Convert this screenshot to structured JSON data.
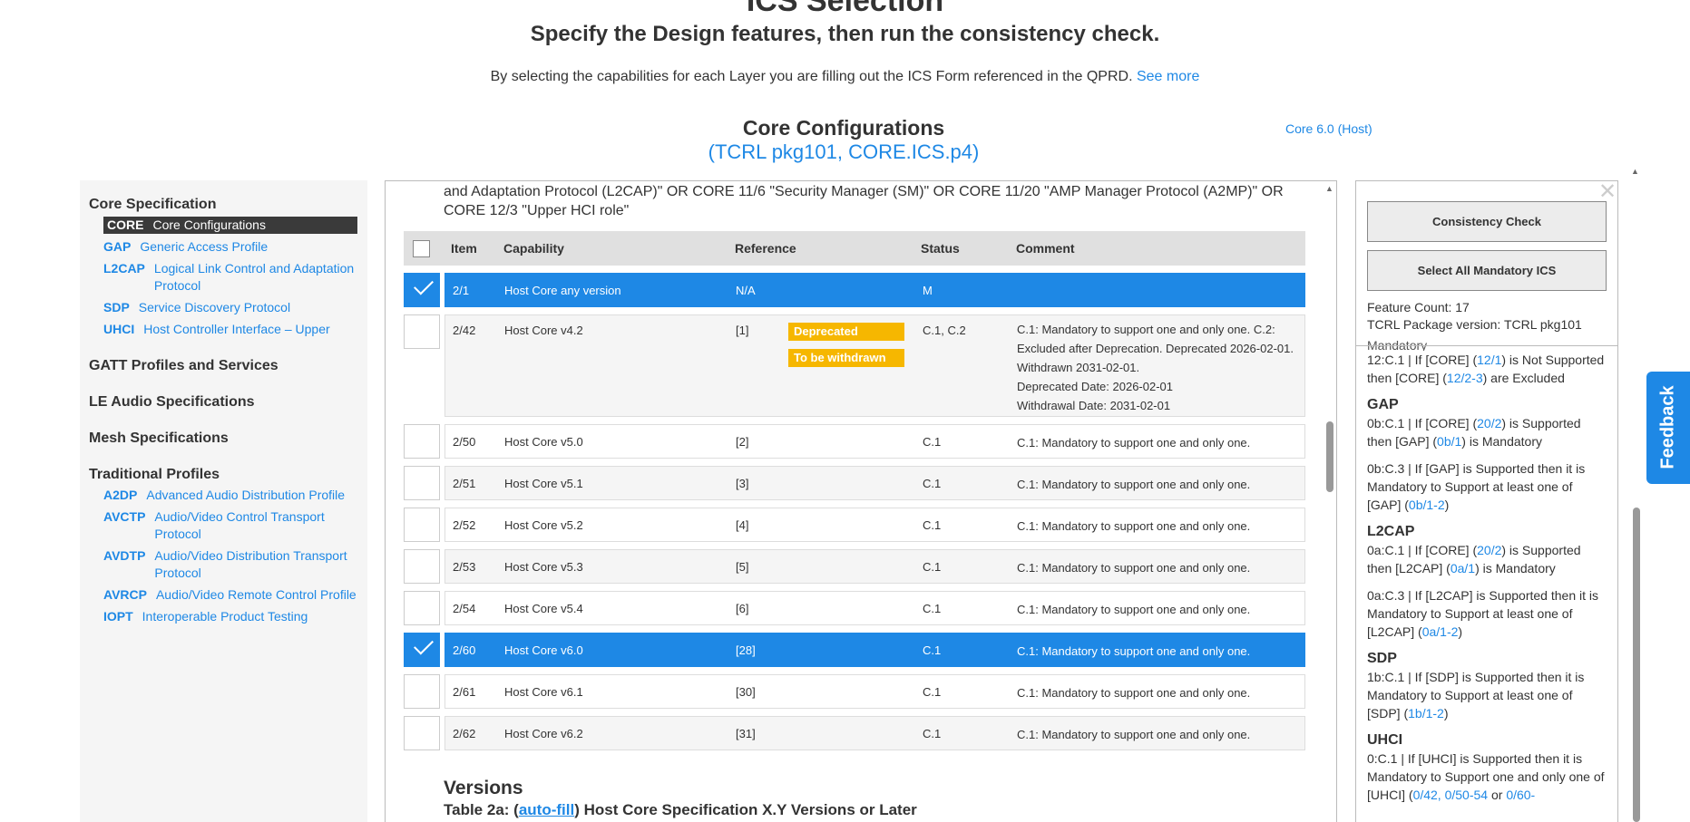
{
  "page": {
    "title": "ICS Selection",
    "subtitle": "Specify the Design features, then run the consistency check.",
    "intro": "By selecting the capabilities for each Layer you are filling out the ICS Form referenced in the QPRD.",
    "see_more": "See more",
    "config_title": "Core Configurations",
    "config_sub": "(TCRL pkg101, CORE.ICS.p4)",
    "version_link": "Core 6.0 (Host)"
  },
  "sidebar": {
    "core_spec": "Core Specification",
    "core_items": [
      {
        "abbr": "CORE",
        "full": "Core Configurations"
      },
      {
        "abbr": "GAP",
        "full": "Generic Access Profile"
      },
      {
        "abbr": "L2CAP",
        "full": "Logical Link Control and Adaptation Protocol"
      },
      {
        "abbr": "SDP",
        "full": "Service Discovery Protocol"
      },
      {
        "abbr": "UHCI",
        "full": "Host Controller Interface – Upper"
      }
    ],
    "gatt": "GATT Profiles and Services",
    "le_audio": "LE Audio Specifications",
    "mesh": "Mesh Specifications",
    "traditional": "Traditional Profiles",
    "trad_items": [
      {
        "abbr": "A2DP",
        "full": "Advanced Audio Distribution Profile"
      },
      {
        "abbr": "AVCTP",
        "full": "Audio/Video Control Transport Protocol"
      },
      {
        "abbr": "AVDTP",
        "full": "Audio/Video Distribution Transport Protocol"
      },
      {
        "abbr": "AVRCP",
        "full": "Audio/Video Remote Control Profile"
      },
      {
        "abbr": "IOPT",
        "full": "Interoperable Product Testing"
      }
    ]
  },
  "center": {
    "intro_text": "and Adaptation Protocol (L2CAP)\" OR CORE 11/6 \"Security Manager (SM)\" OR CORE 11/20 \"AMP Manager Protocol (A2MP)\" OR CORE 12/3 \"Upper HCI role\"",
    "headers": {
      "item": "Item",
      "capability": "Capability",
      "reference": "Reference",
      "status": "Status",
      "comment": "Comment"
    },
    "rows": [
      {
        "item": "2/1",
        "cap": "Host Core any version",
        "ref": "N/A",
        "status": "M",
        "comment": ""
      },
      {
        "item": "2/42",
        "cap": "Host Core v4.2",
        "ref": "[1]",
        "status": "C.1, C.2",
        "comment": "C.1: Mandatory to support one and only one. C.2: Excluded after Deprecation. Deprecated 2026-02-01. Withdrawn 2031-02-01.",
        "deprecated_date": "Deprecated Date: 2026-02-01",
        "withdrawal_date": "Withdrawal Date: 2031-02-01",
        "badge1": "Deprecated",
        "badge2": "To be withdrawn"
      },
      {
        "item": "2/50",
        "cap": "Host Core v5.0",
        "ref": "[2]",
        "status": "C.1",
        "comment": "C.1: Mandatory to support one and only one."
      },
      {
        "item": "2/51",
        "cap": "Host Core v5.1",
        "ref": "[3]",
        "status": "C.1",
        "comment": "C.1: Mandatory to support one and only one."
      },
      {
        "item": "2/52",
        "cap": "Host Core v5.2",
        "ref": "[4]",
        "status": "C.1",
        "comment": "C.1: Mandatory to support one and only one."
      },
      {
        "item": "2/53",
        "cap": "Host Core v5.3",
        "ref": "[5]",
        "status": "C.1",
        "comment": "C.1: Mandatory to support one and only one."
      },
      {
        "item": "2/54",
        "cap": "Host Core v5.4",
        "ref": "[6]",
        "status": "C.1",
        "comment": "C.1: Mandatory to support one and only one."
      },
      {
        "item": "2/60",
        "cap": "Host Core v6.0",
        "ref": "[28]",
        "status": "C.1",
        "comment": "C.1: Mandatory to support one and only one."
      },
      {
        "item": "2/61",
        "cap": "Host Core v6.1",
        "ref": "[30]",
        "status": "C.1",
        "comment": "C.1: Mandatory to support one and only one."
      },
      {
        "item": "2/62",
        "cap": "Host Core v6.2",
        "ref": "[31]",
        "status": "C.1",
        "comment": "C.1: Mandatory to support one and only one."
      }
    ],
    "versions_title": "Versions",
    "table2a_prefix": "Table 2a: (",
    "autofill": "auto-fill",
    "table2a_suffix": ") Host Core Specification X.Y Versions or Later"
  },
  "right": {
    "consistency_btn": "Consistency Check",
    "select_all_btn": "Select All Mandatory ICS",
    "feature_count": "Feature Count: 17",
    "tcrl_version": "TCRL Package version: TCRL pkg101",
    "cut_text": "Mandatory",
    "notes": {
      "core_12c1_a": "12:C.1 | If [CORE] (",
      "core_12c1_link1": "12/1",
      "core_12c1_b": ") is Not Supported then [CORE] (",
      "core_12c1_link2": "12/2-3",
      "core_12c1_c": ") are Excluded",
      "gap_title": "GAP",
      "gap_1a": "0b:C.1 | If [CORE] (",
      "gap_1l": "20/2",
      "gap_1b": ") is Supported then [GAP] (",
      "gap_1l2": "0b/1",
      "gap_1c": ") is Mandatory",
      "gap_2a": "0b:C.3 | If [GAP] is Supported then it is Mandatory to Support at least one of [GAP] (",
      "gap_2l": "0b/1-2",
      "gap_2b": ")",
      "l2cap_title": "L2CAP",
      "l2_1a": "0a:C.1 | If [CORE] (",
      "l2_1l": "20/2",
      "l2_1b": ") is Supported then [L2CAP] (",
      "l2_1l2": "0a/1",
      "l2_1c": ") is Mandatory",
      "l2_2a": "0a:C.3 | If [L2CAP] is Supported then it is Mandatory to Support at least one of [L2CAP] (",
      "l2_2l": "0a/1-2",
      "l2_2b": ")",
      "sdp_title": "SDP",
      "sdp_1a": "1b:C.1 | If [SDP] is Supported then it is Mandatory to Support at least one of [SDP] (",
      "sdp_1l": "1b/1-2",
      "sdp_1b": ")",
      "uhci_title": "UHCI",
      "uhci_1a": "0:C.1 | If [UHCI] is Supported then it is Mandatory to Support one and only one of [UHCI] (",
      "uhci_1l": "0/42, 0/50-54",
      "uhci_1b": " or ",
      "uhci_1l2": "0/60-"
    }
  },
  "feedback": "Feedback",
  "colors": {
    "accent": "#1e88e5",
    "badge": "#f6b700",
    "sidebar_active": "#3a3a3a"
  }
}
